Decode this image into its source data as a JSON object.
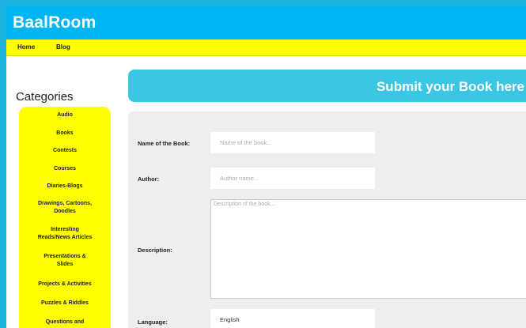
{
  "header": {
    "brand": "BaalRoom"
  },
  "nav": {
    "items": [
      "Home",
      "Blog"
    ]
  },
  "sidebar": {
    "title": "Categories",
    "categories": [
      [
        "Audio"
      ],
      [
        "Books"
      ],
      [
        "Contests"
      ],
      [
        "Courses"
      ],
      [
        "Diaries-Blogs"
      ],
      [
        "Drawings, Cartoons,",
        "Doodles"
      ],
      [
        "Interesting",
        "Reads/News Articles"
      ],
      [
        "Presentations &",
        "Slides"
      ],
      [
        "Projects & Activities"
      ],
      [
        "Puzzles & Riddles"
      ],
      [
        "Questions and"
      ]
    ]
  },
  "banner": {
    "title": "Submit your Book here"
  },
  "form": {
    "name_label": "Name of the Book:",
    "name_placeholder": "Name of the book...",
    "author_label": "Author:",
    "author_placeholder": "Author name...",
    "description_label": "Description:",
    "description_placeholder": "Description of the book...",
    "language_label": "Language:",
    "language_value": "English"
  },
  "colors": {
    "header_bg": "#00b6f2",
    "nav_bg": "#ffff00",
    "banner_bg": "#3cc6e6",
    "form_bg": "#eeeeee"
  }
}
